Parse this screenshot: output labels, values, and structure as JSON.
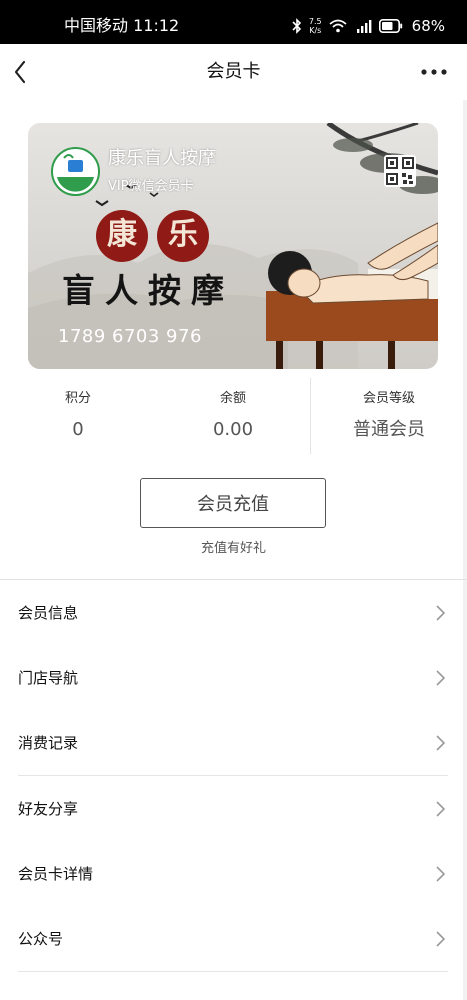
{
  "status_bar": {
    "carrier": "中国移动",
    "time": "11:12",
    "net_speed_value": "7.5",
    "net_speed_unit": "K/s",
    "battery": "68%",
    "icons": [
      "bluetooth-icon",
      "wifi-icon",
      "signal-4g-icon",
      "battery-icon"
    ]
  },
  "nav": {
    "title": "会员卡",
    "back_icon": "chevron-left-icon",
    "more_icon": "more-dots-icon"
  },
  "card": {
    "store_name": "康乐盲人按摩",
    "subtitle": "VIP微信会员卡",
    "logo_text": "康乐盲人按摩",
    "art_title_chars": [
      "康",
      "乐"
    ],
    "art_subtitle": "盲人按摩",
    "card_number": "1789 6703 976",
    "qr_icon": "qr-code-icon"
  },
  "stats": [
    {
      "label": "积分",
      "value": "0"
    },
    {
      "label": "余额",
      "value": "0.00"
    },
    {
      "label": "会员等级",
      "value": "普通会员"
    }
  ],
  "recharge": {
    "button_label": "会员充值",
    "tip": "充值有好礼"
  },
  "menu": [
    {
      "label": "会员信息"
    },
    {
      "label": "门店导航"
    },
    {
      "label": "消费记录"
    },
    {
      "label": "好友分享"
    },
    {
      "label": "会员卡详情"
    },
    {
      "label": "公众号"
    }
  ],
  "colors": {
    "seal_red": "#8f1a16",
    "logo_green": "#2f9d4b",
    "table_brown": "#9a4a1c"
  }
}
